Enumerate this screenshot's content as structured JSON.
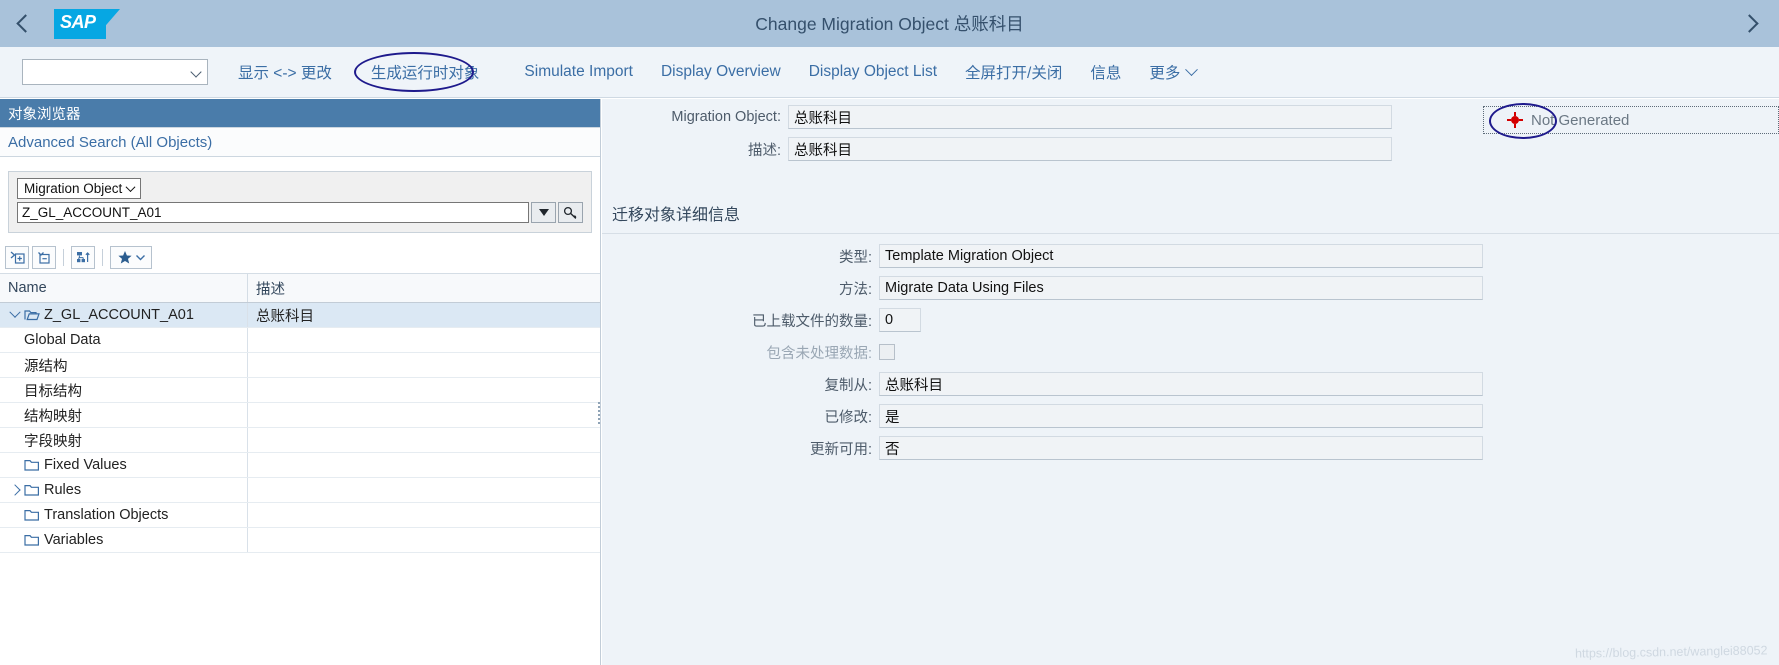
{
  "shell": {
    "back_icon": "chevron-left-icon",
    "forward_icon": "chevron-right-icon",
    "logo_text": "SAP",
    "title": "Change Migration Object 总账科目"
  },
  "toolbar": {
    "dropdown_value": "",
    "buttons": [
      {
        "label": "显示 <-> 更改",
        "highlighted": false
      },
      {
        "label": "生成运行时对象",
        "highlighted": true
      },
      {
        "label": "Simulate Import",
        "highlighted": false
      },
      {
        "label": "Display Overview",
        "highlighted": false
      },
      {
        "label": "Display Object List",
        "highlighted": false
      },
      {
        "label": "全屏打开/关闭",
        "highlighted": false
      },
      {
        "label": "信息",
        "highlighted": false
      }
    ],
    "more_label": "更多"
  },
  "left_panel": {
    "header": "对象浏览器",
    "advanced_search": "Advanced Search (All Objects)",
    "search": {
      "type_label": "Migration Object",
      "value": "Z_GL_ACCOUNT_A01",
      "dropdown_icon": "triangle-down-icon",
      "value_help_icon": "value-help-icon"
    },
    "tree_toolbar": [
      {
        "name": "expand-all-icon"
      },
      {
        "name": "collapse-all-icon"
      },
      {
        "name": "hierarchy-sort-icon"
      },
      {
        "name": "favorites-star-icon"
      }
    ],
    "columns": [
      "Name",
      "描述"
    ],
    "rows": [
      {
        "name": "Z_GL_ACCOUNT_A01",
        "desc": "总账科目",
        "indent": 0,
        "twisty": "down",
        "icon": "folder-open-icon",
        "selected": true
      },
      {
        "name": "Global Data",
        "desc": "",
        "indent": 2,
        "twisty": "",
        "icon": "",
        "selected": false
      },
      {
        "name": "源结构",
        "desc": "",
        "indent": 2,
        "twisty": "",
        "icon": "",
        "selected": false
      },
      {
        "name": "目标结构",
        "desc": "",
        "indent": 2,
        "twisty": "",
        "icon": "",
        "selected": false
      },
      {
        "name": "结构映射",
        "desc": "",
        "indent": 2,
        "twisty": "",
        "icon": "",
        "selected": false
      },
      {
        "name": "字段映射",
        "desc": "",
        "indent": 2,
        "twisty": "",
        "icon": "",
        "selected": false
      },
      {
        "name": "Fixed Values",
        "desc": "",
        "indent": 1,
        "twisty": "",
        "icon": "folder-icon",
        "selected": false
      },
      {
        "name": "Rules",
        "desc": "",
        "indent": 1,
        "twisty": "right",
        "icon": "folder-icon",
        "selected": false
      },
      {
        "name": "Translation Objects",
        "desc": "",
        "indent": 1,
        "twisty": "",
        "icon": "folder-icon",
        "selected": false
      },
      {
        "name": "Variables",
        "desc": "",
        "indent": 1,
        "twisty": "",
        "icon": "folder-icon",
        "selected": false
      }
    ]
  },
  "right_panel": {
    "header_fields": [
      {
        "label": "Migration Object:",
        "value": "总账科目"
      },
      {
        "label": "描述:",
        "value": "总账科目"
      }
    ],
    "status": {
      "icon": "not-generated-status-icon",
      "text": "Not Generated",
      "color": "#d40000",
      "highlight_color": "#1e1a8c"
    },
    "section_title": "迁移对象详细信息",
    "detail_fields": [
      {
        "label": "类型:",
        "value": "Template Migration Object",
        "type": "text",
        "width": "long",
        "dim": false
      },
      {
        "label": "方法:",
        "value": "Migrate Data Using Files",
        "type": "text",
        "width": "long",
        "dim": false
      },
      {
        "label": "已上载文件的数量:",
        "value": "0",
        "type": "text",
        "width": "tiny",
        "dim": false
      },
      {
        "label": "包含未处理数据:",
        "value": "",
        "type": "checkbox",
        "width": "",
        "dim": true
      },
      {
        "label": "复制从:",
        "value": "总账科目",
        "type": "text",
        "width": "long",
        "dim": false
      },
      {
        "label": "已修改:",
        "value": "是",
        "type": "text",
        "width": "long",
        "dim": false
      },
      {
        "label": "更新可用:",
        "value": "否",
        "type": "text",
        "width": "long",
        "dim": false
      }
    ],
    "watermark": "https://blog.csdn.net/wanglei88052"
  }
}
